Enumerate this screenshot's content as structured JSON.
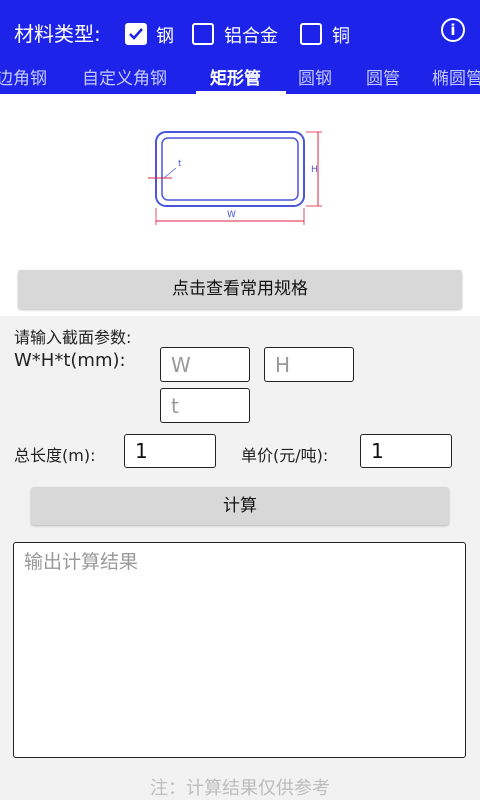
{
  "materials": {
    "label": "材料类型:",
    "options": [
      {
        "label": "钢",
        "checked": true
      },
      {
        "label": "铝合金",
        "checked": false
      },
      {
        "label": "铜",
        "checked": false
      }
    ]
  },
  "info_icon": "info-icon",
  "tabs": [
    {
      "label": "边角钢"
    },
    {
      "label": "自定义角钢"
    },
    {
      "label": "矩形管",
      "active": true
    },
    {
      "label": "圆钢"
    },
    {
      "label": "圆管"
    },
    {
      "label": "椭圆管"
    }
  ],
  "diagram": {
    "label_t": "t",
    "label_h": "H",
    "label_w": "W"
  },
  "spec_button": "点击查看常用规格",
  "section_title": "请输入截面参数:",
  "dims": {
    "label": "W*H*t(mm):",
    "w_placeholder": "W",
    "h_placeholder": "H",
    "t_placeholder": "t"
  },
  "length": {
    "label": "总长度(m):",
    "value": "1"
  },
  "price": {
    "label": "单价(元/吨):",
    "value": "1"
  },
  "calc_button": "计算",
  "output_placeholder": "输出计算结果",
  "note": "注：计算结果仅供参考",
  "colors": {
    "header": "#1d23e8",
    "diagram_stroke": "#4a57d8",
    "dim_line": "#e02040"
  }
}
